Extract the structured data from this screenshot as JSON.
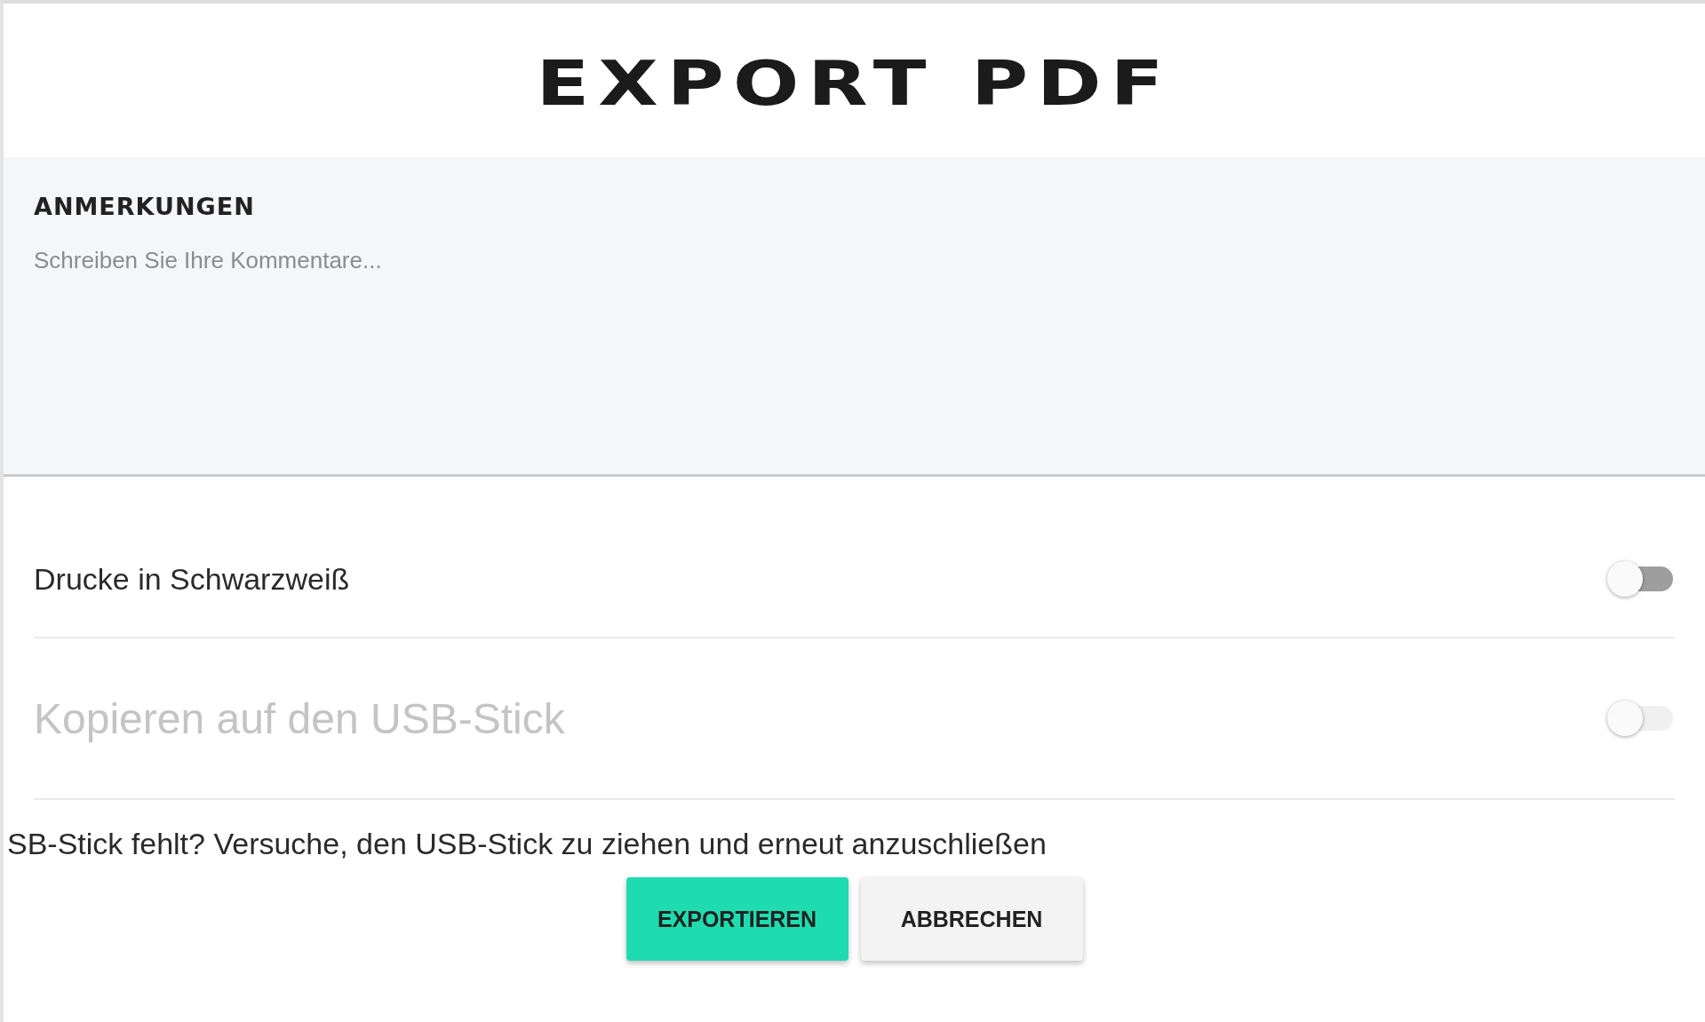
{
  "title": "EXPORT PDF",
  "notes": {
    "label": "ANMERKUNGEN",
    "placeholder": "Schreiben Sie Ihre Kommentare..."
  },
  "options": [
    {
      "label": "Drucke in Schwarzweiß",
      "on": false,
      "disabled": false
    },
    {
      "label": "Kopieren auf den USB-Stick",
      "on": false,
      "disabled": true
    }
  ],
  "hint": "SB-Stick fehlt? Versuche, den USB-Stick zu ziehen und erneut anzuschließen",
  "buttons": [
    {
      "label": "EXPORTIEREN",
      "kind": "primary"
    },
    {
      "label": "ABBRECHEN",
      "kind": "secondary"
    }
  ]
}
